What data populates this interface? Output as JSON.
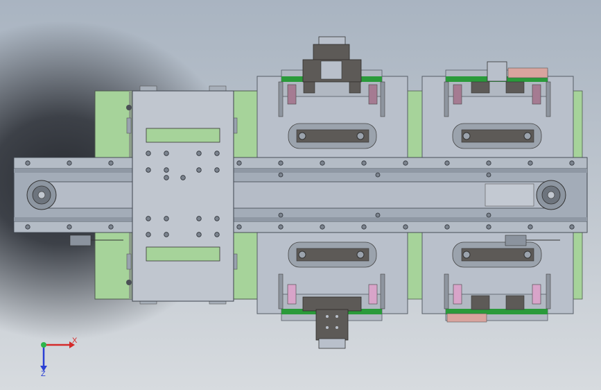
{
  "viewport": {
    "title": "",
    "background_top": "#a9b4c1",
    "background_bottom": "#d7dbdf"
  },
  "model": {
    "frame_color": "#a3acb8",
    "plate_color": "#b9c0cb",
    "green_panel_color": "#a6d39a",
    "green_strip_color": "#2a9a3a",
    "dark_part_color": "#5d5a57",
    "pink_part_color": "#d8a49e",
    "purple_part_color": "#a57b92"
  },
  "triad": {
    "x_label": "X",
    "z_label": "Z",
    "x_color": "#d42a2a",
    "y_color": "#2db54a",
    "z_color": "#2a3fd4"
  }
}
